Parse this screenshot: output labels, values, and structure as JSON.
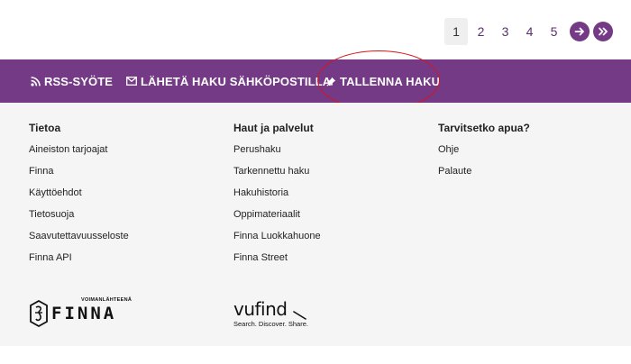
{
  "pagination": {
    "pages": [
      "1",
      "2",
      "3",
      "4",
      "5"
    ],
    "current": "1",
    "next_icon": "arrow-right-icon",
    "last_icon": "double-chevron-right-icon"
  },
  "actionbar": {
    "rss_label": "RSS-SYÖTE",
    "email_label": "LÄHETÄ HAKU SÄHKÖPOSTILLA",
    "save_label": "TALLENNA HAKU"
  },
  "footer": {
    "col1": {
      "title": "Tietoa",
      "items": [
        "Aineiston tarjoajat",
        "Finna",
        "Käyttöehdot",
        "Tietosuoja",
        "Saavutettavuusseloste",
        "Finna API"
      ]
    },
    "col2": {
      "title": "Haut ja palvelut",
      "items": [
        "Perushaku",
        "Tarkennettu haku",
        "Hakuhistoria",
        "Oppimateriaalit",
        "Finna Luokkahuone",
        "Finna Street"
      ]
    },
    "col3": {
      "title": "Tarvitsetko apua?",
      "items": [
        "Ohje",
        "Palaute"
      ]
    },
    "finna_logo": {
      "tagline": "VOIMANLÄHTEENÄ",
      "word": "FINNA"
    },
    "vufind_logo": {
      "word": "vufind",
      "tagline": "Search. Discover. Share."
    }
  },
  "colors": {
    "brand_purple": "#743a86",
    "annotation_red": "#d9141b",
    "footer_bg": "#f5f5f5"
  }
}
